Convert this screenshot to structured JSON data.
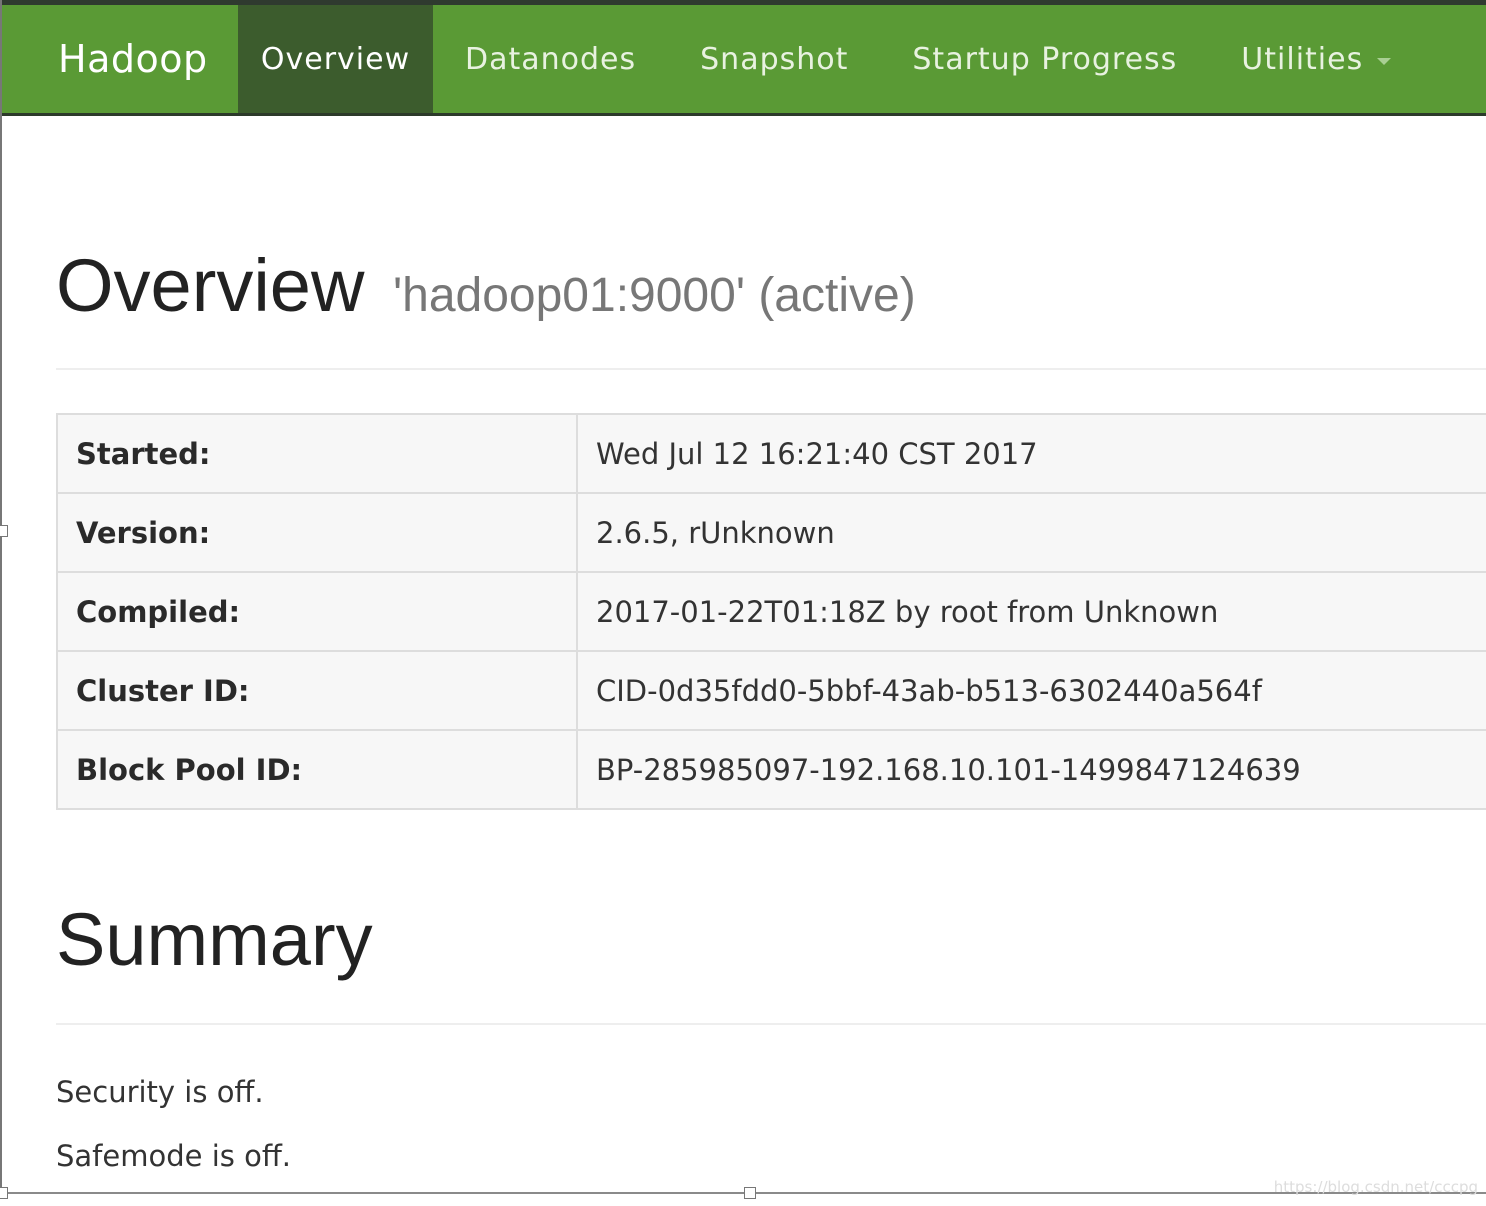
{
  "navbar": {
    "brand": "Hadoop",
    "items": [
      {
        "label": "Overview",
        "active": true
      },
      {
        "label": "Datanodes",
        "active": false
      },
      {
        "label": "Snapshot",
        "active": false
      },
      {
        "label": "Startup Progress",
        "active": false
      },
      {
        "label": "Utilities",
        "active": false,
        "dropdown": true
      }
    ]
  },
  "overview": {
    "title": "Overview",
    "subtitle": "'hadoop01:9000' (active)"
  },
  "info_table": [
    {
      "key": "Started:",
      "value": "Wed Jul 12 16:21:40 CST 2017"
    },
    {
      "key": "Version:",
      "value": "2.6.5, rUnknown"
    },
    {
      "key": "Compiled:",
      "value": "2017-01-22T01:18Z by root from Unknown"
    },
    {
      "key": "Cluster ID:",
      "value": "CID-0d35fdd0-5bbf-43ab-b513-6302440a564f"
    },
    {
      "key": "Block Pool ID:",
      "value": "BP-285985097-192.168.10.101-1499847124639"
    }
  ],
  "summary": {
    "title": "Summary",
    "security": "Security is off.",
    "safemode": "Safemode is off."
  },
  "watermark": "https://blog.csdn.net/cccpg",
  "colors": {
    "navbar_bg": "#5a9a35",
    "navbar_active": "#3c5c2d",
    "table_bg": "#f7f7f7"
  }
}
